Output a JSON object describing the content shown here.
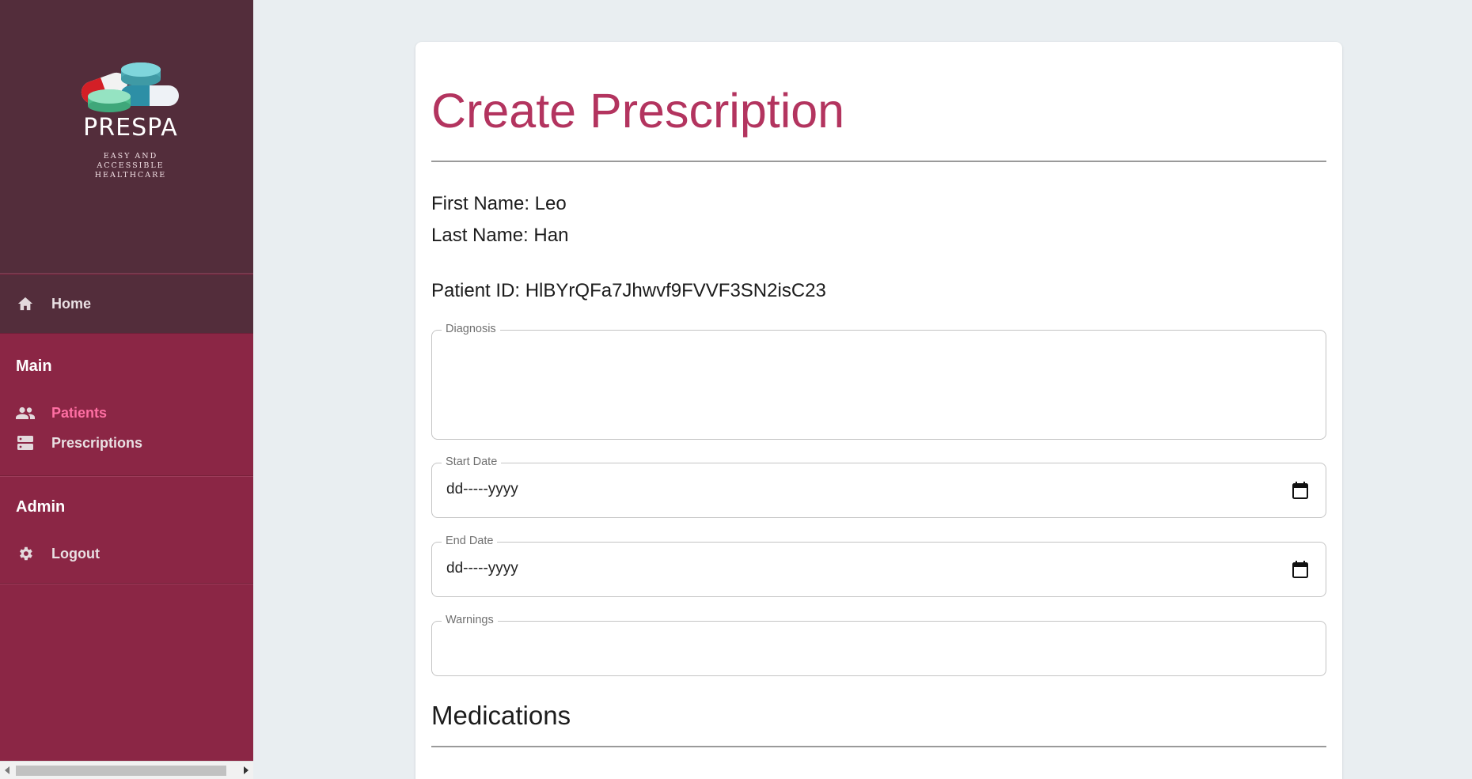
{
  "brand": {
    "name": "PRESPA",
    "tagline_line1": "EASY AND ACCESSIBLE",
    "tagline_line2": "HEALTHCARE"
  },
  "sidebar": {
    "home": {
      "label": "Home",
      "icon": "home-icon"
    },
    "main_section": {
      "title": "Main",
      "items": [
        {
          "label": "Patients",
          "icon": "people-icon",
          "active": true
        },
        {
          "label": "Prescriptions",
          "icon": "storage-icon",
          "active": false
        }
      ]
    },
    "admin_section": {
      "title": "Admin",
      "items": [
        {
          "label": "Logout",
          "icon": "gear-icon"
        }
      ]
    }
  },
  "form": {
    "title": "Create Prescription",
    "first_name": "First Name: Leo",
    "last_name": "Last Name: Han",
    "patient_id": "Patient ID: HlBYrQFa7Jhwvf9FVVF3SN2isC23",
    "diagnosis_label": "Diagnosis",
    "diagnosis_value": "",
    "start_date_label": "Start Date",
    "start_date_value": "dd-----yyyy",
    "end_date_label": "End Date",
    "end_date_value": "dd-----yyyy",
    "warnings_label": "Warnings",
    "warnings_value": "",
    "medications_title": "Medications"
  },
  "colors": {
    "sidebar_bg": "#8b2645",
    "sidebar_header_bg": "#532d3b",
    "active_nav": "#ff6fa3",
    "title_color": "#b3345f",
    "page_bg": "#e9eef1"
  }
}
